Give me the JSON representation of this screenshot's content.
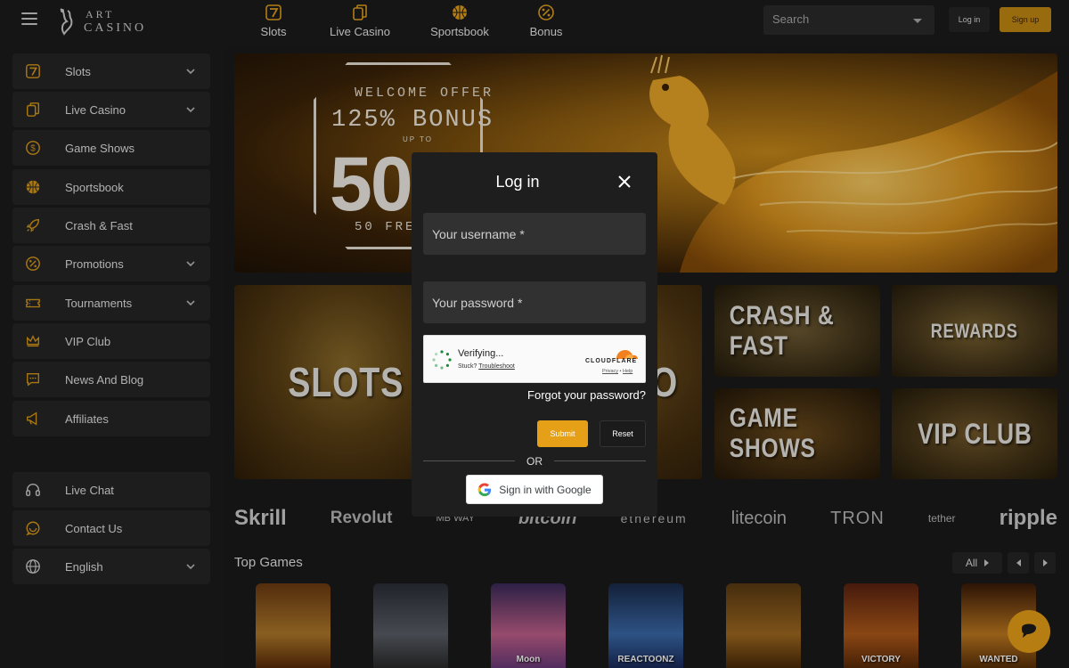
{
  "header": {
    "logo_line1": "ART",
    "logo_line2": "CASINO",
    "nav": [
      {
        "label": "Slots",
        "icon": "seven-icon"
      },
      {
        "label": "Live Casino",
        "icon": "cards-icon"
      },
      {
        "label": "Sportsbook",
        "icon": "basketball-icon"
      },
      {
        "label": "Bonus",
        "icon": "percent-icon"
      }
    ],
    "search_placeholder": "Search",
    "login_label": "Log in",
    "signup_label": "Sign up"
  },
  "sidebar": {
    "items": [
      {
        "label": "Slots",
        "icon": "seven-icon"
      },
      {
        "label": "Live Casino",
        "icon": "cards-icon"
      },
      {
        "label": "Game Shows",
        "icon": "coin-icon"
      },
      {
        "label": "Sportsbook",
        "icon": "basketball-icon"
      },
      {
        "label": "Crash & Fast",
        "icon": "rocket-icon"
      },
      {
        "label": "Promotions",
        "icon": "percent-icon"
      },
      {
        "label": "Tournaments",
        "icon": "ticket-icon"
      },
      {
        "label": "VIP Club",
        "icon": "crown-icon"
      },
      {
        "label": "News And Blog",
        "icon": "chat-icon"
      },
      {
        "label": "Affiliates",
        "icon": "megaphone-icon"
      }
    ],
    "bottom": [
      {
        "label": "Live Chat",
        "icon": "headset-icon"
      },
      {
        "label": "Contact Us",
        "icon": "support-chat-icon"
      },
      {
        "label": "English",
        "icon": "globe-icon"
      }
    ]
  },
  "banner": {
    "line1": "WELCOME OFFER",
    "line2": "125% BONUS",
    "line3": "UP TO",
    "line4": "50",
    "line5": "50 FREE"
  },
  "tiles": {
    "slots": "SLOTS",
    "live": "IO",
    "crash": "CRASH & FAST",
    "rewards": "REWARDS",
    "game_shows": "GAME SHOWS",
    "vip": "VIP CLUB"
  },
  "payments": [
    "Skrill",
    "Revolut",
    "MB WAY",
    "bitcoin",
    "ethereum",
    "litecoin",
    "TRON",
    "tether",
    "ripple"
  ],
  "top_games": {
    "title": "Top Games",
    "filter": "All",
    "games": [
      "",
      "",
      "Moon",
      "REACTOONZ",
      "",
      "VICTORY",
      "WANTED"
    ]
  },
  "login_modal": {
    "title": "Log in",
    "username_placeholder": "Your username *",
    "password_placeholder": "Your password *",
    "captcha_status": "Verifying...",
    "captcha_stuck": "Stuck?",
    "captcha_troubleshoot": "Troubleshoot",
    "captcha_brand": "CLOUDFLARE",
    "captcha_privacy": "Privacy",
    "captcha_help": "Help",
    "forgot": "Forgot your password?",
    "submit": "Submit",
    "reset": "Reset",
    "or": "OR",
    "google": "Sign in with Google"
  },
  "colors": {
    "accent": "#e6a018",
    "bg": "#1a1a1a",
    "panel": "#262626"
  }
}
